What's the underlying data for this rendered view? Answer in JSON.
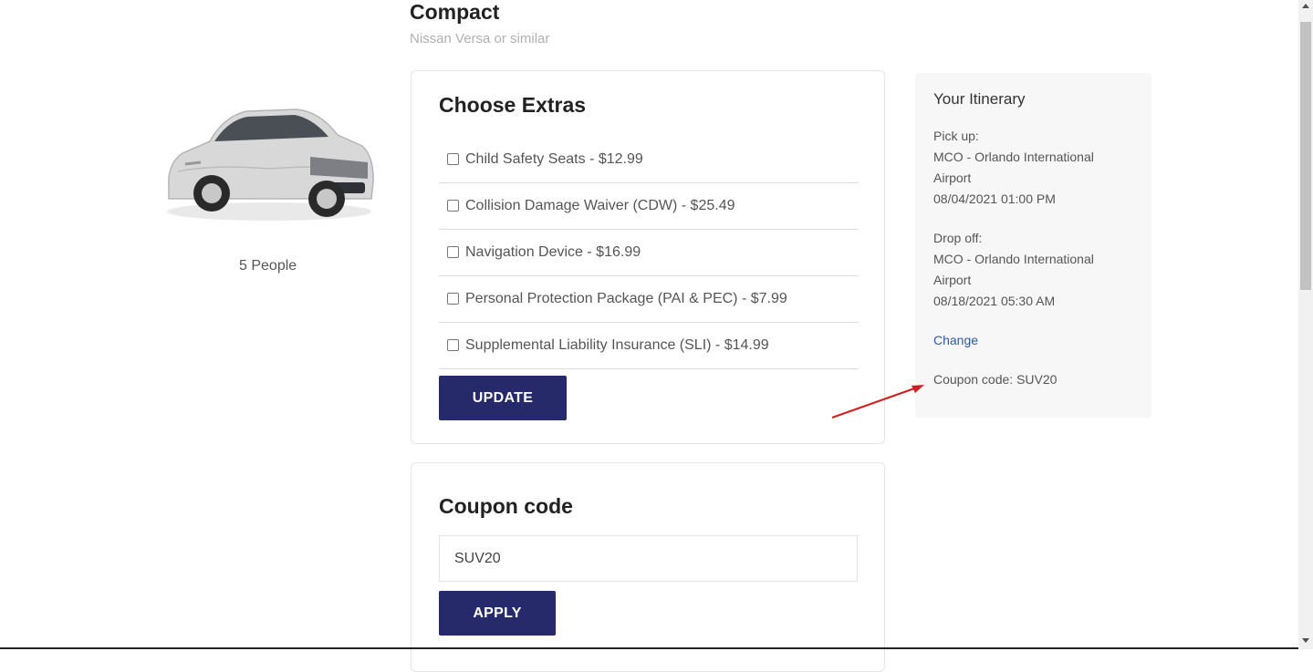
{
  "vehicle": {
    "class": "Compact",
    "model": "Nissan Versa or similar",
    "capacity": "5 People",
    "image_icon": "car-image"
  },
  "extras": {
    "title": "Choose Extras",
    "items": [
      {
        "label": "Child Safety Seats - $12.99",
        "checked": false
      },
      {
        "label": "Collision Damage Waiver (CDW) - $25.49",
        "checked": false
      },
      {
        "label": "Navigation Device - $16.99",
        "checked": false
      },
      {
        "label": "Personal Protection Package (PAI & PEC) - $7.99",
        "checked": false
      },
      {
        "label": "Supplemental Liability Insurance (SLI) - $14.99",
        "checked": false
      }
    ],
    "update_label": "UPDATE"
  },
  "coupon": {
    "title": "Coupon code",
    "value": "SUV20",
    "apply_label": "APPLY"
  },
  "itinerary": {
    "title": "Your Itinerary",
    "pickup_label": "Pick up:",
    "pickup_location_line1": "MCO - Orlando International",
    "pickup_location_line2": "Airport",
    "pickup_datetime": "08/04/2021 01:00 PM",
    "dropoff_label": "Drop off:",
    "dropoff_location_line1": "MCO - Orlando International",
    "dropoff_location_line2": "Airport",
    "dropoff_datetime": "08/18/2021 05:30 AM",
    "change_label": "Change",
    "coupon_text": "Coupon code: SUV20"
  },
  "colors": {
    "button_bg": "#262a6b",
    "link": "#2a5d9f",
    "annotation_arrow": "#d02020"
  }
}
